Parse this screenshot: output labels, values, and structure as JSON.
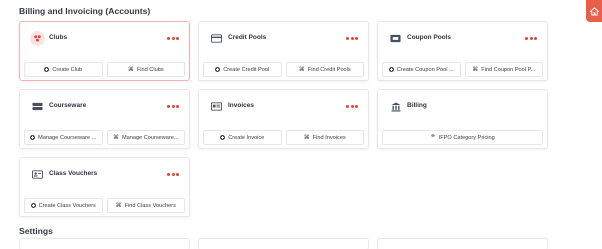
{
  "sections": {
    "billing_title": "Billing and Invoicing (Accounts)",
    "settings_title": "Settings"
  },
  "cards": {
    "clubs": {
      "title": "Clubs",
      "icon": "clubs-icon",
      "actions": [
        "Create Club",
        "Find Clubs"
      ]
    },
    "credit_pools": {
      "title": "Credit Pools",
      "icon": "credit-card-icon",
      "actions": [
        "Create Credit Pool",
        "Find Credit Pools"
      ]
    },
    "coupon_pools": {
      "title": "Coupon Pools",
      "icon": "coupon-icon",
      "actions": [
        "Create Coupon Pool ...",
        "Find Coupon Pool P..."
      ]
    },
    "courseware": {
      "title": "Courseware",
      "icon": "courseware-icon",
      "actions": [
        "Manage Courseware ...",
        "Manage Courseware..."
      ]
    },
    "invoices": {
      "title": "Invoices",
      "icon": "invoice-icon",
      "actions": [
        "Create Invoice",
        "Find Invoices"
      ]
    },
    "billing": {
      "title": "Billing",
      "icon": "bank-icon",
      "actions": [
        "IFPO Category Pricing"
      ]
    },
    "class_vouchers": {
      "title": "Class Vouchers",
      "icon": "voucher-icon",
      "actions": [
        "Create Class Vouchers",
        "Find Class Vouchers"
      ]
    }
  },
  "colors": {
    "accent": "#e0453a",
    "active_border": "#f2b3b3",
    "side_tab": "#e8604c"
  }
}
